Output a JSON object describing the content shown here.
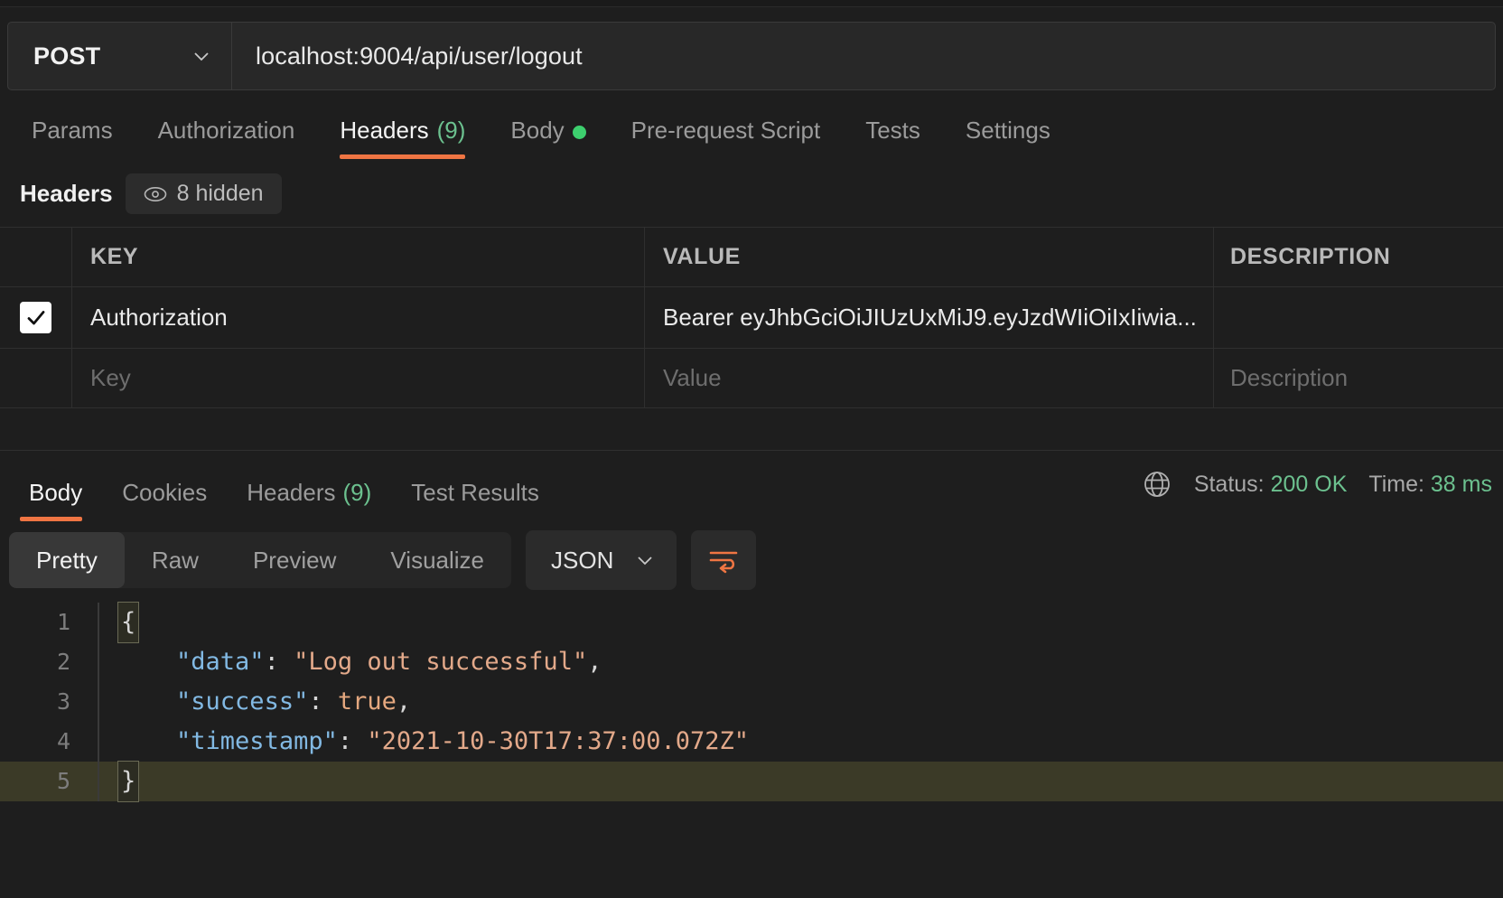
{
  "request": {
    "method": "POST",
    "url": "localhost:9004/api/user/logout",
    "tabs": [
      {
        "label": "Params",
        "count": "",
        "active": false,
        "dot": false
      },
      {
        "label": "Authorization",
        "count": "",
        "active": false,
        "dot": false
      },
      {
        "label": "Headers",
        "count": "(9)",
        "active": true,
        "dot": false
      },
      {
        "label": "Body",
        "count": "",
        "active": false,
        "dot": true
      },
      {
        "label": "Pre-request Script",
        "count": "",
        "active": false,
        "dot": false
      },
      {
        "label": "Tests",
        "count": "",
        "active": false,
        "dot": false
      },
      {
        "label": "Settings",
        "count": "",
        "active": false,
        "dot": false
      }
    ]
  },
  "headers_section": {
    "title": "Headers",
    "hidden_pill": "8 hidden",
    "hidden_icon": "eye-icon",
    "columns": [
      "KEY",
      "VALUE",
      "DESCRIPTION"
    ],
    "rows": [
      {
        "checked": true,
        "key": "Authorization",
        "value": "Bearer eyJhbGciOiJIUzUxMiJ9.eyJzdWIiOiIxIiwia...",
        "description": ""
      }
    ],
    "placeholders": {
      "key": "Key",
      "value": "Value",
      "description": "Description"
    }
  },
  "response": {
    "tabs": [
      {
        "label": "Body",
        "count": "",
        "active": true
      },
      {
        "label": "Cookies",
        "count": "",
        "active": false
      },
      {
        "label": "Headers",
        "count": "(9)",
        "active": false
      },
      {
        "label": "Test Results",
        "count": "",
        "active": false
      }
    ],
    "globe_icon": "globe-icon",
    "status_label": "Status:",
    "status_value": "200 OK",
    "time_label": "Time:",
    "time_value": "38 ms",
    "format_tabs": [
      {
        "label": "Pretty",
        "active": true
      },
      {
        "label": "Raw",
        "active": false
      },
      {
        "label": "Preview",
        "active": false
      },
      {
        "label": "Visualize",
        "active": false
      }
    ],
    "language": "JSON",
    "wrap_icon": "word-wrap-icon",
    "body_lines": [
      {
        "no": "1",
        "highlight": false,
        "brace": "{",
        "parts": []
      },
      {
        "no": "2",
        "highlight": false,
        "brace": "",
        "parts": [
          {
            "t": "    ",
            "c": "k-punc"
          },
          {
            "t": "\"data\"",
            "c": "k-key"
          },
          {
            "t": ": ",
            "c": "k-punc"
          },
          {
            "t": "\"Log out successful\"",
            "c": "k-str"
          },
          {
            "t": ",",
            "c": "k-punc"
          }
        ]
      },
      {
        "no": "3",
        "highlight": false,
        "brace": "",
        "parts": [
          {
            "t": "    ",
            "c": "k-punc"
          },
          {
            "t": "\"success\"",
            "c": "k-key"
          },
          {
            "t": ": ",
            "c": "k-punc"
          },
          {
            "t": "true",
            "c": "k-bool"
          },
          {
            "t": ",",
            "c": "k-punc"
          }
        ]
      },
      {
        "no": "4",
        "highlight": false,
        "brace": "",
        "parts": [
          {
            "t": "    ",
            "c": "k-punc"
          },
          {
            "t": "\"timestamp\"",
            "c": "k-key"
          },
          {
            "t": ": ",
            "c": "k-punc"
          },
          {
            "t": "\"2021-10-30T17:37:00.072Z\"",
            "c": "k-str"
          }
        ]
      },
      {
        "no": "5",
        "highlight": true,
        "brace": "}",
        "parts": []
      }
    ]
  },
  "colors": {
    "accent": "#ef7543",
    "success": "#6cc18f",
    "body_dot": "#3dcf6e",
    "background": "#1e1e1e"
  }
}
